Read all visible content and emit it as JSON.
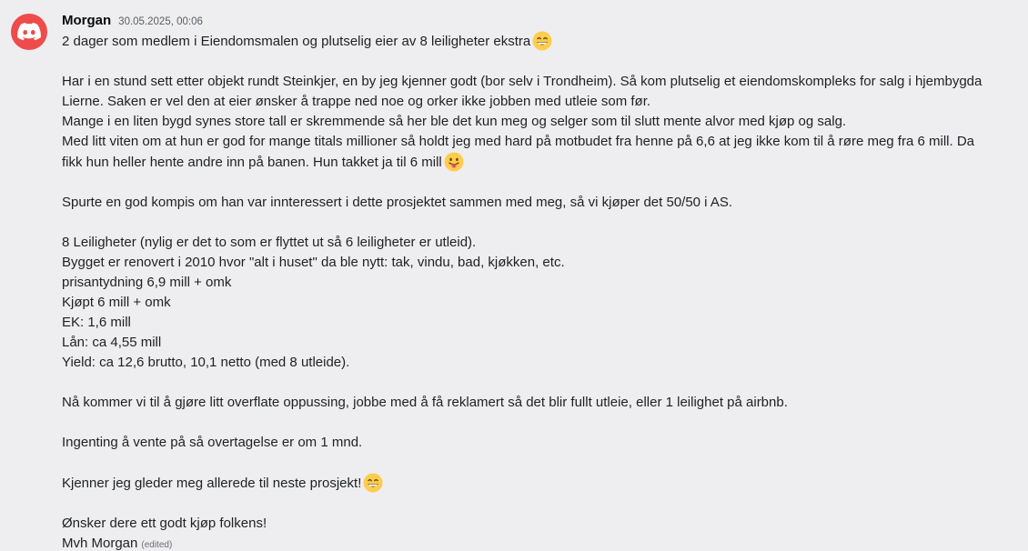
{
  "message": {
    "author": "Morgan",
    "timestamp": "30.05.2025, 00:06",
    "edited_label": "(edited)",
    "avatar_icon": "discord-logo-icon",
    "avatar_color": "#ef4b4b",
    "lines": {
      "l1": "2 dager som medlem i Eiendomsmalen og plutselig eier av 8 leiligheter ekstra",
      "l2": "Har i en stund sett etter objekt rundt Steinkjer, en by jeg kjenner godt (bor selv i Trondheim). Så kom plutselig et eiendomskompleks for salg i hjembygda",
      "l3": "Lierne. Saken er vel den at eier ønsker å trappe ned noe og orker ikke jobben med utleie som før.",
      "l4": "Mange i en liten bygd synes store tall er skremmende så her ble det kun meg og selger som til slutt mente alvor med kjøp og salg.",
      "l5": "Med litt viten om at hun er god for mange titals millioner så holdt jeg med hard på motbudet fra henne på 6,6 at jeg ikke kom til å røre meg fra 6 mill. Da",
      "l6": "fikk hun heller hente andre inn på banen. Hun takket ja til 6 mill",
      "l7": "Spurte en god kompis om han var innteressert i dette prosjektet sammen med meg, så vi kjøper det 50/50 i AS.",
      "l8": "8 Leiligheter (nylig er det to som er flyttet ut så 6 leiligheter er utleid).",
      "l9": "Bygget er renovert i 2010 hvor \"alt i huset\" da ble nytt: tak, vindu, bad, kjøkken, etc.",
      "l10": "prisantydning 6,9 mill + omk",
      "l11": "Kjøpt 6 mill + omk",
      "l12": "EK: 1,6 mill",
      "l13": "Lån: ca 4,55 mill",
      "l14": "Yield: ca 12,6 brutto, 10,1 netto (med 8 utleide).",
      "l15": "Nå kommer vi til å gjøre litt overflate oppussing, jobbe med å få reklamert så det blir fullt utleie, eller 1 leilighet på airbnb.",
      "l16": "Ingenting å vente på så overtagelse er om 1 mnd.",
      "l17": "Kjenner jeg gleder meg allerede til neste prosjekt!",
      "l18": "Ønsker dere ett godt kjøp folkens!",
      "l19": "Mvh Morgan"
    },
    "emojis": {
      "grin": "grinning-face-with-smiling-eyes-icon",
      "tongue": "face-with-tongue-icon"
    }
  }
}
